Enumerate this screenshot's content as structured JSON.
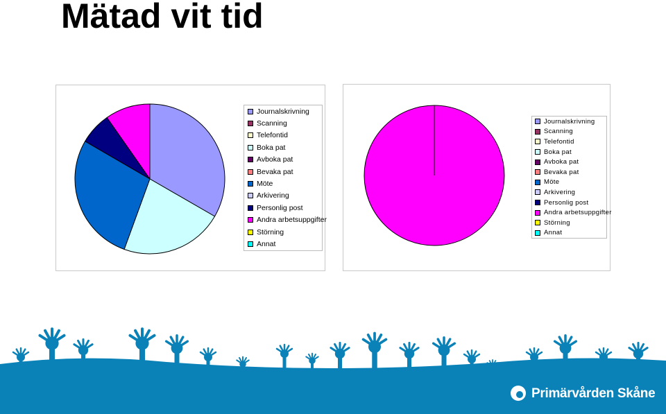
{
  "title": "Mätad vit tid",
  "legend_labels": [
    "Journalskrivning",
    "Scanning",
    "Telefontid",
    "Boka pat",
    "Avboka pat",
    "Bevaka pat",
    "Möte",
    "Arkivering",
    "Personlig post",
    "Andra arbetsuppgifter",
    "Störning",
    "Annat"
  ],
  "legend_colors": [
    "#9999ff",
    "#993366",
    "#ffffcc",
    "#ccffff",
    "#660066",
    "#ff8080",
    "#0066cc",
    "#ccccff",
    "#000080",
    "#ff00ff",
    "#ffff00",
    "#00ffff"
  ],
  "chart_data": [
    {
      "type": "pie",
      "title": "",
      "categories": [
        "Journalskrivning",
        "Scanning",
        "Telefontid",
        "Boka pat",
        "Avboka pat",
        "Bevaka pat",
        "Möte",
        "Arkivering",
        "Personlig post",
        "Andra arbetsuppgifter",
        "Störning",
        "Annat"
      ],
      "values": [
        33.3,
        0,
        0,
        22.2,
        0,
        0,
        27.8,
        0,
        6.9,
        9.7,
        0,
        0
      ],
      "legend": "right"
    },
    {
      "type": "pie",
      "title": "",
      "categories": [
        "Journalskrivning",
        "Scanning",
        "Telefontid",
        "Boka pat",
        "Avboka pat",
        "Bevaka pat",
        "Möte",
        "Arkivering",
        "Personlig post",
        "Andra arbetsuppgifter",
        "Störning",
        "Annat"
      ],
      "values": [
        0,
        0,
        0,
        0,
        0,
        0,
        0,
        0,
        0,
        100,
        0,
        0
      ],
      "legend": "right"
    }
  ],
  "footer": {
    "logo_text": "Primärvården Skåne",
    "band_color": "#0a82b8"
  }
}
